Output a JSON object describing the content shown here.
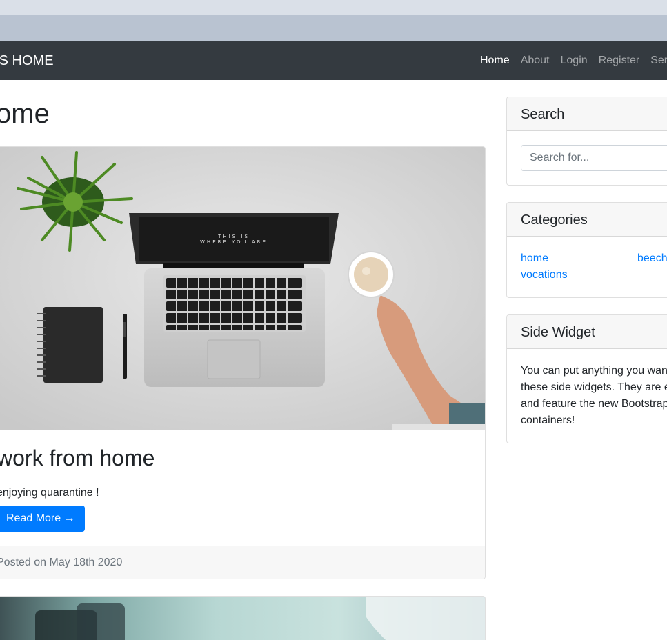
{
  "navbar": {
    "brand": "MS HOME",
    "links": [
      "Home",
      "About",
      "Login",
      "Register",
      "Ser"
    ]
  },
  "page": {
    "heading": "ome"
  },
  "posts": [
    {
      "title": "work from home",
      "excerpt": "enjoying quarantine !",
      "button": "Read More →",
      "footer": "Posted on May 18th 2020",
      "laptop_screen_text": "THIS IS WHERE YOU ARE"
    }
  ],
  "sidebar": {
    "search": {
      "title": "Search",
      "placeholder": "Search for..."
    },
    "categories": {
      "title": "Categories",
      "items": [
        "home",
        "beech",
        "vocations"
      ]
    },
    "side_widget": {
      "title": "Side Widget",
      "text": "You can put anything you want inside of these side widgets. They are easy to use, and feature the new Bootstrap 4 card containers!"
    }
  },
  "colors": {
    "navbar_bg": "#343a40",
    "primary": "#007bff",
    "link": "#007bff"
  }
}
